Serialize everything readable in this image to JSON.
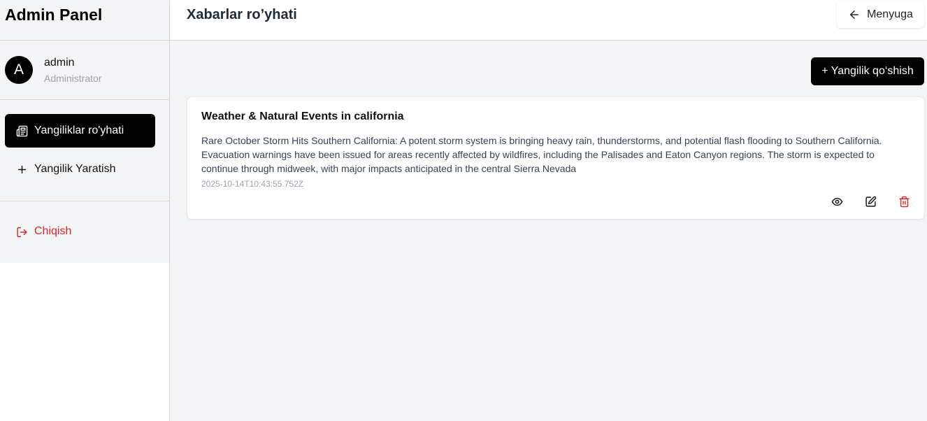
{
  "sidebar": {
    "brand": "Admin Panel",
    "user": {
      "initial": "A",
      "name": "admin",
      "role": "Administrator"
    },
    "items": [
      {
        "label": "Yangiliklar ro'yhati",
        "icon": "newspaper-icon",
        "active": true
      },
      {
        "label": "Yangilik Yaratish",
        "icon": "plus-icon",
        "active": false
      }
    ],
    "logout": {
      "label": "Chiqish",
      "icon": "logout-icon",
      "color": "#dc2626"
    }
  },
  "header": {
    "title": "Xabarlar ro’yhati",
    "back_label": "Menyuga",
    "back_icon": "arrow-left-icon"
  },
  "main": {
    "add_label": "+ Yangilik qo‘shish",
    "news": [
      {
        "title": "Weather & Natural Events in california",
        "body": "Rare October Storm Hits Southern California: A potent storm system is bringing heavy rain, thunderstorms, and potential flash flooding to Southern California. Evacuation warnings have been issued for areas recently affected by wildfires, including the Palisades and Eaton Canyon regions. The storm is expected to continue through midweek, with major impacts anticipated in the central Sierra Nevada",
        "date": "2025-10-14T10:43:55.752Z",
        "actions": [
          "eye-icon",
          "edit-icon",
          "trash-icon"
        ]
      }
    ]
  },
  "colors": {
    "accent": "#000000",
    "danger": "#dc2626",
    "background": "#f3f4f6"
  }
}
